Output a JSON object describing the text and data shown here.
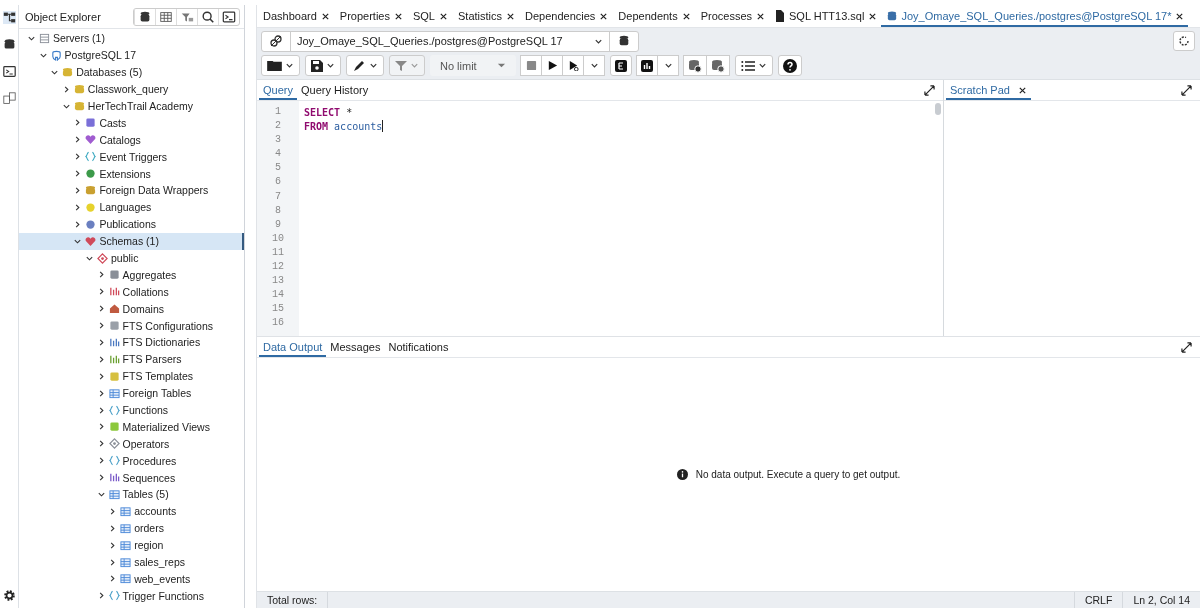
{
  "explorer": {
    "title": "Object Explorer",
    "tree": [
      {
        "label": "Servers (1)",
        "kind": "servers",
        "expanded": true,
        "selected": false,
        "children": [
          {
            "label": "PostgreSQL 17",
            "kind": "server",
            "expanded": true,
            "selected": false,
            "children": [
              {
                "label": "Databases (5)",
                "kind": "databases",
                "expanded": true,
                "selected": false,
                "children": [
                  {
                    "label": "Classwork_query",
                    "kind": "database",
                    "expanded": false,
                    "selected": false
                  },
                  {
                    "label": "HerTechTrail Academy",
                    "kind": "database",
                    "expanded": true,
                    "selected": false,
                    "children": [
                      {
                        "label": "Casts",
                        "kind": "casts",
                        "expanded": false,
                        "selected": false
                      },
                      {
                        "label": "Catalogs",
                        "kind": "catalogs",
                        "expanded": false,
                        "selected": false
                      },
                      {
                        "label": "Event Triggers",
                        "kind": "triggers",
                        "expanded": false,
                        "selected": false
                      },
                      {
                        "label": "Extensions",
                        "kind": "extensions",
                        "expanded": false,
                        "selected": false
                      },
                      {
                        "label": "Foreign Data Wrappers",
                        "kind": "fdw",
                        "expanded": false,
                        "selected": false
                      },
                      {
                        "label": "Languages",
                        "kind": "languages",
                        "expanded": false,
                        "selected": false
                      },
                      {
                        "label": "Publications",
                        "kind": "publications",
                        "expanded": false,
                        "selected": false
                      },
                      {
                        "label": "Schemas (1)",
                        "kind": "schemas",
                        "expanded": true,
                        "selected": true,
                        "children": [
                          {
                            "label": "public",
                            "kind": "schema",
                            "expanded": true,
                            "selected": false,
                            "children": [
                              {
                                "label": "Aggregates",
                                "kind": "aggregates",
                                "expanded": false,
                                "selected": false
                              },
                              {
                                "label": "Collations",
                                "kind": "collations",
                                "expanded": false,
                                "selected": false
                              },
                              {
                                "label": "Domains",
                                "kind": "domains",
                                "expanded": false,
                                "selected": false
                              },
                              {
                                "label": "FTS Configurations",
                                "kind": "ftsconf",
                                "expanded": false,
                                "selected": false
                              },
                              {
                                "label": "FTS Dictionaries",
                                "kind": "ftsdict",
                                "expanded": false,
                                "selected": false
                              },
                              {
                                "label": "FTS Parsers",
                                "kind": "ftsparser",
                                "expanded": false,
                                "selected": false
                              },
                              {
                                "label": "FTS Templates",
                                "kind": "ftstemplate",
                                "expanded": false,
                                "selected": false
                              },
                              {
                                "label": "Foreign Tables",
                                "kind": "foreigntables",
                                "expanded": false,
                                "selected": false
                              },
                              {
                                "label": "Functions",
                                "kind": "functions",
                                "expanded": false,
                                "selected": false
                              },
                              {
                                "label": "Materialized Views",
                                "kind": "matviews",
                                "expanded": false,
                                "selected": false
                              },
                              {
                                "label": "Operators",
                                "kind": "operators",
                                "expanded": false,
                                "selected": false
                              },
                              {
                                "label": "Procedures",
                                "kind": "procedures",
                                "expanded": false,
                                "selected": false
                              },
                              {
                                "label": "Sequences",
                                "kind": "sequences",
                                "expanded": false,
                                "selected": false
                              },
                              {
                                "label": "Tables (5)",
                                "kind": "tables",
                                "expanded": true,
                                "selected": false,
                                "children": [
                                  {
                                    "label": "accounts",
                                    "kind": "table",
                                    "expanded": false,
                                    "selected": false
                                  },
                                  {
                                    "label": "orders",
                                    "kind": "table",
                                    "expanded": false,
                                    "selected": false
                                  },
                                  {
                                    "label": "region",
                                    "kind": "table",
                                    "expanded": false,
                                    "selected": false
                                  },
                                  {
                                    "label": "sales_reps",
                                    "kind": "table",
                                    "expanded": false,
                                    "selected": false
                                  },
                                  {
                                    "label": "web_events",
                                    "kind": "table",
                                    "expanded": false,
                                    "selected": false
                                  }
                                ]
                              },
                              {
                                "label": "Trigger Functions",
                                "kind": "functions",
                                "expanded": false,
                                "selected": false
                              }
                            ]
                          }
                        ]
                      }
                    ]
                  }
                ]
              }
            ]
          }
        ]
      }
    ]
  },
  "tabs": [
    {
      "label": "Dashboard",
      "kind": "plain",
      "selected": false
    },
    {
      "label": "Properties",
      "kind": "plain",
      "selected": false
    },
    {
      "label": "SQL",
      "kind": "plain",
      "selected": false
    },
    {
      "label": "Statistics",
      "kind": "plain",
      "selected": false
    },
    {
      "label": "Dependencies",
      "kind": "plain",
      "selected": false
    },
    {
      "label": "Dependents",
      "kind": "plain",
      "selected": false
    },
    {
      "label": "Processes",
      "kind": "plain",
      "selected": false
    },
    {
      "label": "SQL HTT13.sql",
      "kind": "file",
      "selected": false
    },
    {
      "label": "Joy_Omaye_SQL_Queries./postgres@PostgreSQL 17*",
      "kind": "query",
      "selected": true
    }
  ],
  "connection": {
    "value": "Joy_Omaye_SQL_Queries./postgres@PostgreSQL 17"
  },
  "toolbar": {
    "limit": "No limit"
  },
  "editor_tabs": [
    {
      "label": "Query",
      "selected": true
    },
    {
      "label": "Query History",
      "selected": false
    }
  ],
  "editor": {
    "line_numbers": [
      "1",
      "2",
      "3",
      "4",
      "5",
      "6",
      "7",
      "8",
      "9",
      "10",
      "11",
      "12",
      "13",
      "14",
      "15",
      "16"
    ],
    "lines": [
      [
        {
          "kind": "keyword",
          "text": "SELECT"
        },
        {
          "kind": "plain",
          "text": "*"
        }
      ],
      [
        {
          "kind": "keyword",
          "text": "FROM"
        },
        {
          "kind": "name",
          "text": "accounts"
        }
      ]
    ]
  },
  "scratch_pad": {
    "title": "Scratch Pad"
  },
  "output_tabs": [
    {
      "label": "Data Output",
      "selected": true
    },
    {
      "label": "Messages",
      "selected": false
    },
    {
      "label": "Notifications",
      "selected": false
    }
  ],
  "output": {
    "message": "No data output. Execute a query to get output."
  },
  "status_bar": {
    "total_rows": "Total rows:",
    "line_ending": "CRLF",
    "position": "Ln 2, Col 14"
  }
}
